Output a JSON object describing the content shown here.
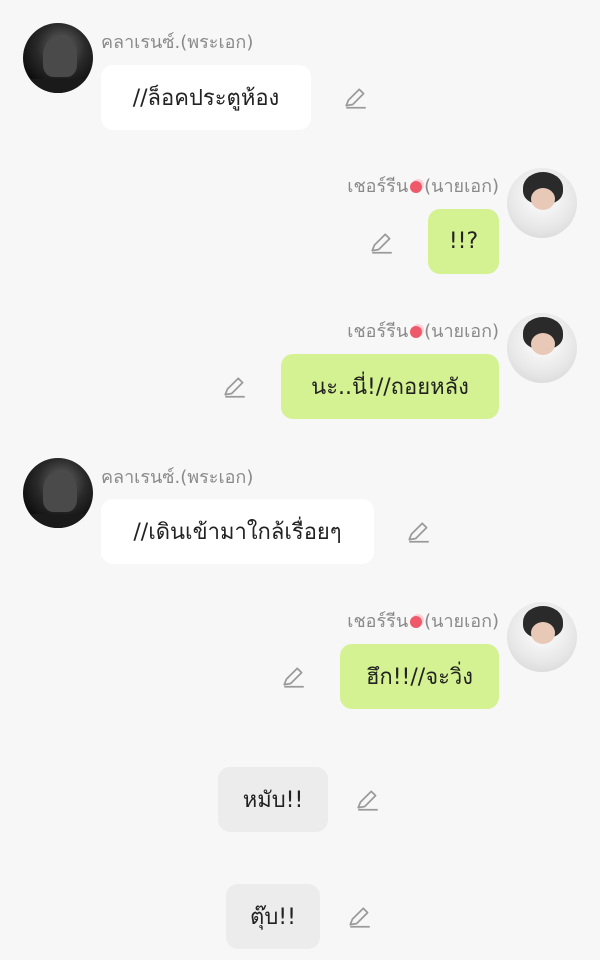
{
  "messages": [
    {
      "sender": "คลาเรนซ์.(พระเอก)",
      "text": "//ล็อคประตูห้อง",
      "side": "left"
    },
    {
      "sender": "เชอร์รีน",
      "sender_suffix": "(นายเอก)",
      "text": "!!?",
      "side": "right"
    },
    {
      "sender": "เชอร์รีน",
      "sender_suffix": "(นายเอก)",
      "text": "นะ..นี่!//ถอยหลัง",
      "side": "right"
    },
    {
      "sender": "คลาเรนซ์.(พระเอก)",
      "text": "//เดินเข้ามาใกล้เรื่อยๆ",
      "side": "left"
    },
    {
      "sender": "เชอร์รีน",
      "sender_suffix": "(นายเอก)",
      "text": "ฮึก!!//จะวิ่ง",
      "side": "right"
    },
    {
      "text": "หมับ!!",
      "side": "center"
    },
    {
      "text": "ตุ๊บ!!",
      "side": "center"
    }
  ],
  "colors": {
    "background": "#f7f7f7",
    "bubble_left": "#ffffff",
    "bubble_right": "#d4f291",
    "bubble_narration": "#ececec",
    "name_text": "#8a8a8a"
  },
  "icons": {
    "edit": "pencil-icon",
    "heart": "heart-icon"
  }
}
